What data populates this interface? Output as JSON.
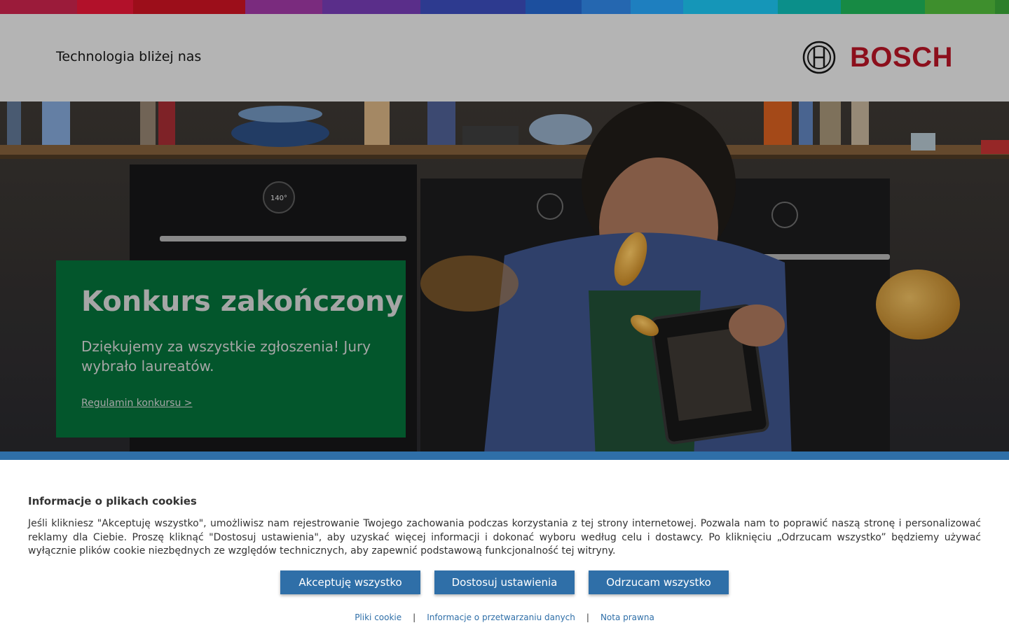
{
  "colors": {
    "header_bg": "#b4b4b4",
    "brand_red": "#8c0f1c",
    "promo_green": "#03562c",
    "cookie_blue": "#2f6fa8"
  },
  "header": {
    "tagline": "Technologia bliżej nas",
    "logo_text": "BOSCH",
    "logo_icon": "bosch-armature-icon"
  },
  "hero": {
    "title": "Konkurs zakończony",
    "text": "Dziękujemy za wszystkie zgłoszenia! Jury wybrało laureatów.",
    "link": "Regulamin konkursu >",
    "oven_display": "140°"
  },
  "cookie": {
    "title": "Informacje o plikach cookies",
    "text": "Jeśli klikniesz \"Akceptuję wszystko\", umożliwisz nam rejestrowanie Twojego zachowania podczas korzystania z tej strony internetowej. Pozwala nam to poprawić naszą stronę i personalizować reklamy dla Ciebie. Proszę kliknąć \"Dostosuj ustawienia\", aby uzyskać więcej informacji i dokonać wyboru według celu i dostawcy. Po kliknięciu „Odrzucam wszystko” będziemy używać wyłącznie plików cookie niezbędnych ze względów technicznych, aby zapewnić podstawową funkcjonalność tej witryny.",
    "buttons": {
      "accept": "Akceptuję wszystko",
      "customize": "Dostosuj ustawienia",
      "reject": "Odrzucam wszystko"
    },
    "links": {
      "cookies": "Pliki cookie",
      "data": "Informacje o przetwarzaniu danych",
      "legal": "Nota prawna",
      "separator": "|"
    }
  }
}
